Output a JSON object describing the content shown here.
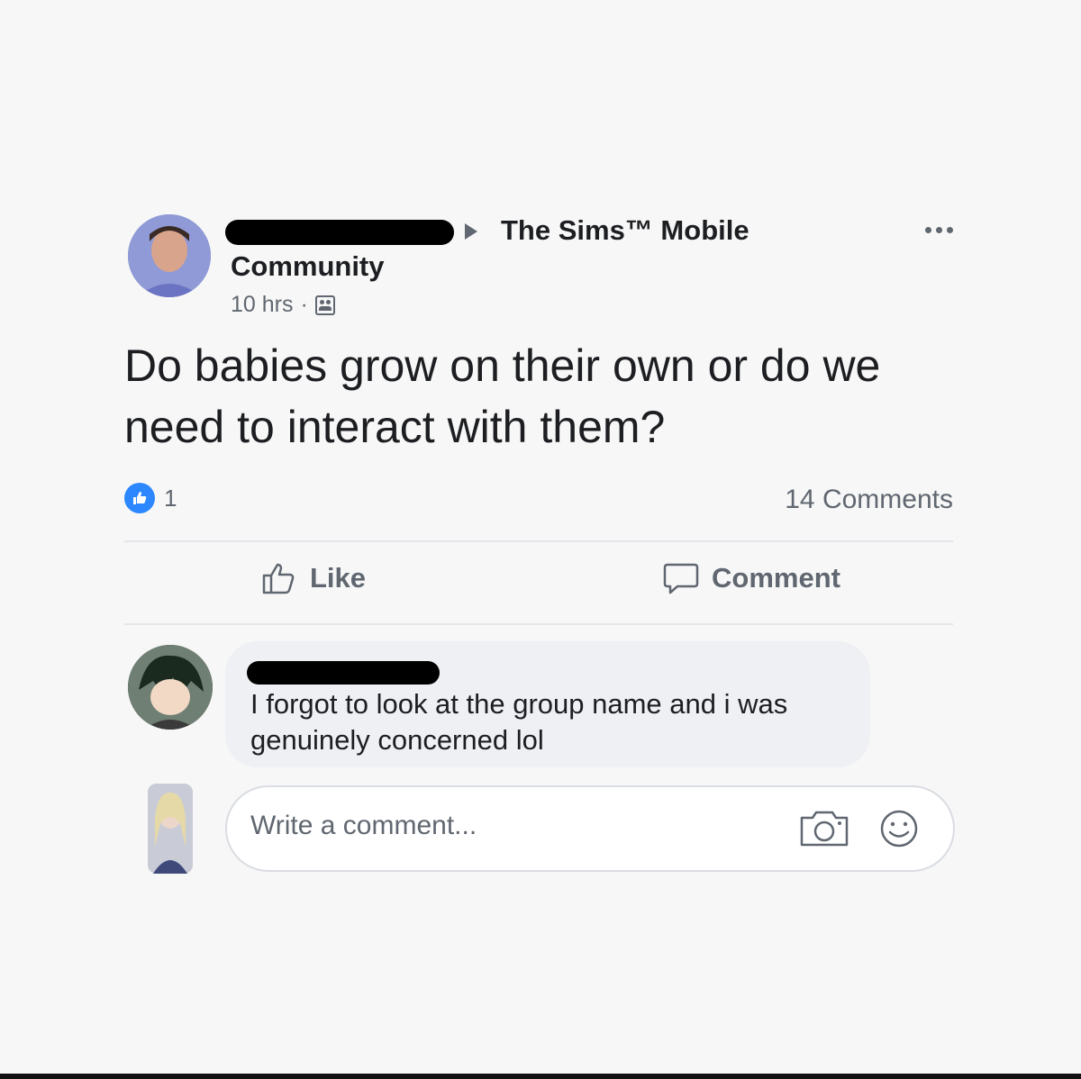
{
  "post": {
    "group_name": "The Sims™ Mobile",
    "author_line2": "Community",
    "time": "10 hrs",
    "separator": "·",
    "audience_icon": "group-icon",
    "more_icon": "ellipsis-icon",
    "text": "Do babies grow on their own or do we need to interact with them?",
    "reaction_count": "1",
    "comments_count_label": "14 Comments"
  },
  "actions": {
    "like_label": "Like",
    "comment_label": "Comment"
  },
  "comments": [
    {
      "text": "I forgot to look at the group name and i was genuinely concerned lol"
    }
  ],
  "composer": {
    "placeholder": "Write a comment...",
    "camera_icon": "camera-icon",
    "emoji_icon": "emoji-icon"
  },
  "colors": {
    "like_blue": "#2d88ff",
    "muted_text": "#606770",
    "bubble_bg": "#eef0f3"
  }
}
